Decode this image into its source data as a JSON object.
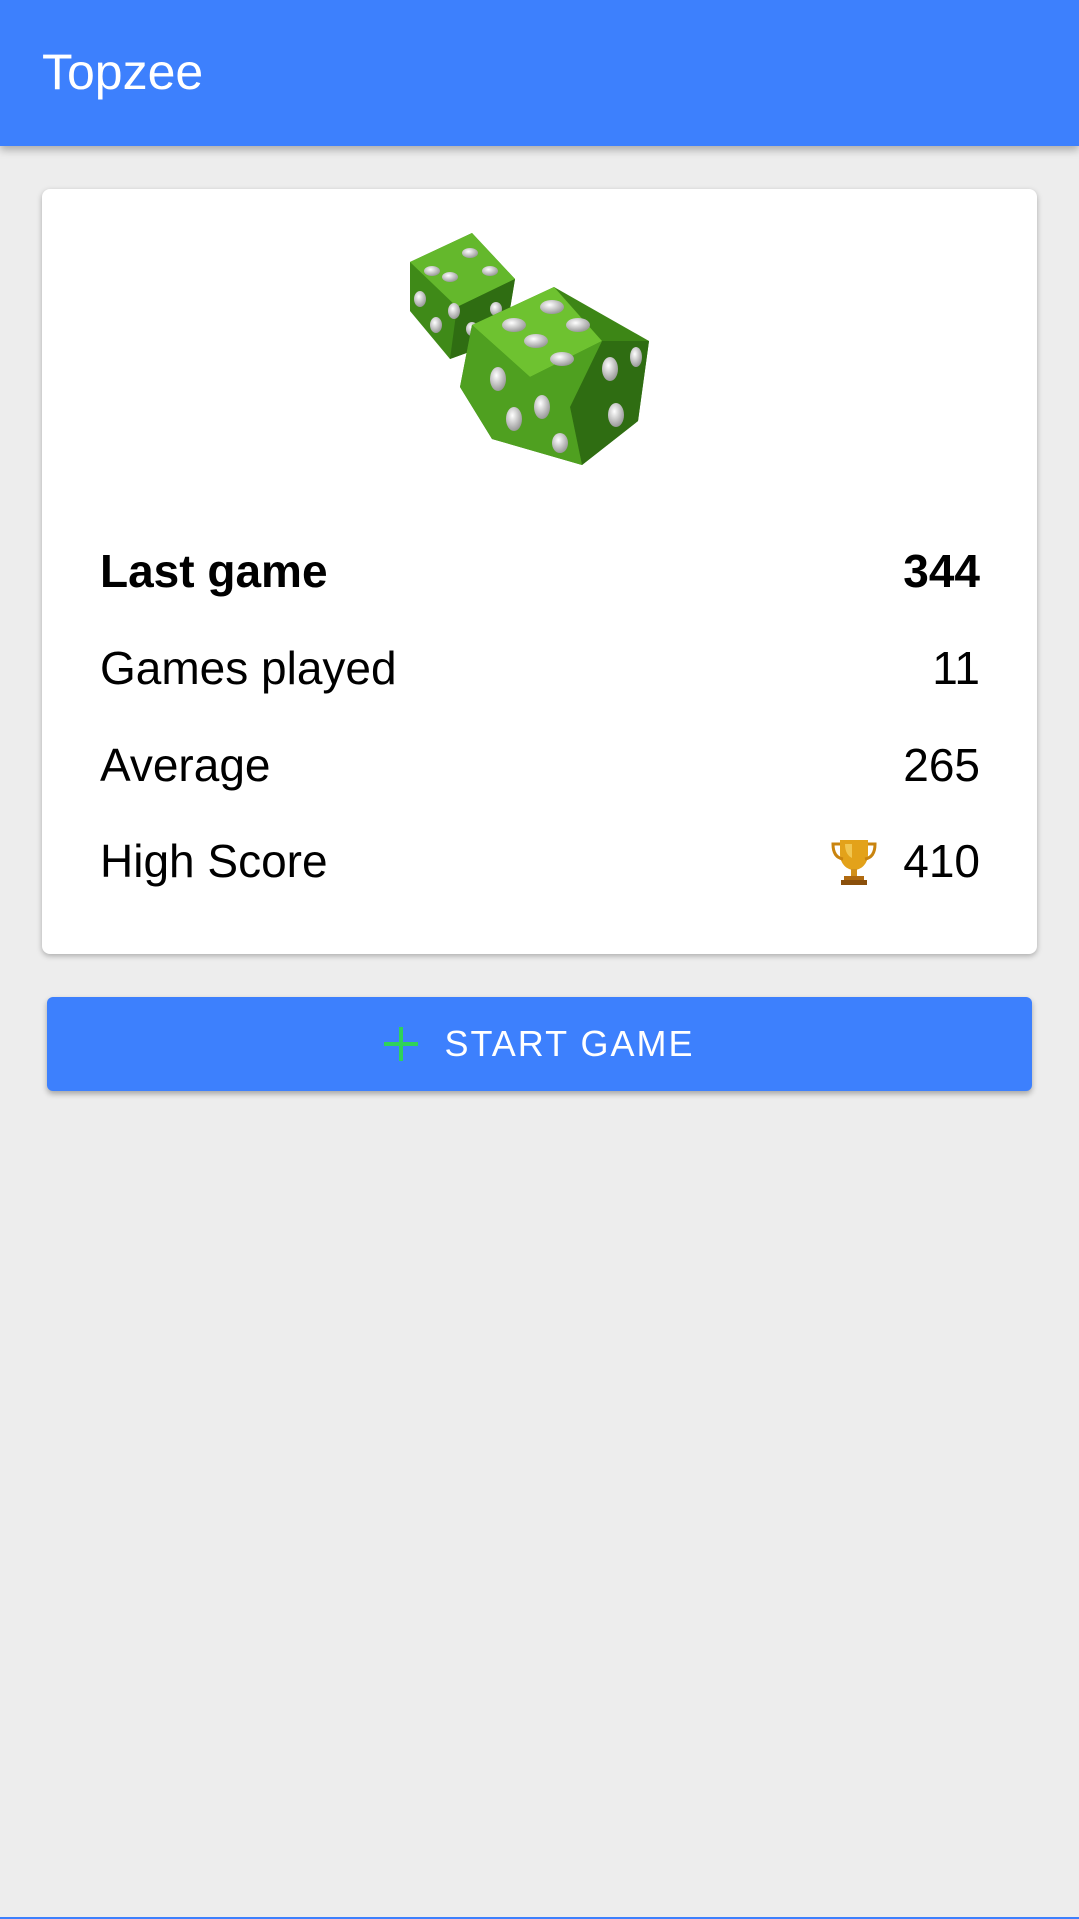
{
  "app": {
    "title": "Topzee"
  },
  "card": {
    "image_icon": "dice-icon",
    "stats": [
      {
        "label": "Last game",
        "value": "344"
      },
      {
        "label": "Games played",
        "value": "11"
      },
      {
        "label": "Average",
        "value": "265"
      },
      {
        "label": "High Score",
        "value": "410",
        "icon": "trophy-icon"
      }
    ]
  },
  "actions": {
    "start_label": "START GAME",
    "start_icon": "plus-icon"
  },
  "colors": {
    "primary": "#3d80fd",
    "background": "#ededed",
    "dice_green": "#4a9a1c",
    "plus_green": "#2fd25a"
  }
}
